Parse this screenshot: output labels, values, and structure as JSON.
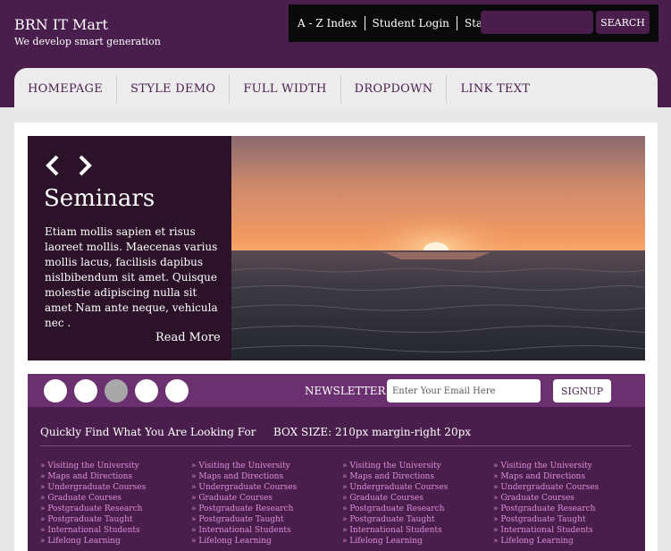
{
  "brand": {
    "name": "BRN IT Mart",
    "tagline": "We develop smart generation"
  },
  "toplinks": [
    "A - Z Index",
    "Student Login",
    "Staff Login"
  ],
  "search": {
    "button": "SEARCH"
  },
  "nav": [
    "HOMEPAGE",
    "STYLE DEMO",
    "FULL WIDTH",
    "DROPDOWN",
    "LINK TEXT"
  ],
  "slide": {
    "title": "Seminars",
    "body": "Etiam mollis sapien et risus laoreet mollis. Maecenas varius mollis lacus, facilisis dapibus nislbibendum sit amet. Quisque molestie adipiscing nulla sit amet Nam ante neque, vehicula nec .",
    "more": "Read More",
    "prev_icon": "chevron-left-icon",
    "next_icon": "chevron-right-icon"
  },
  "pager": {
    "count": 5,
    "active_index": 2
  },
  "newsletter": {
    "label": "NEWSLETTER:",
    "placeholder": "Enter Your Email Here",
    "button": "SIGNUP"
  },
  "quick": {
    "heading": "Quickly Find What You Are Looking For",
    "box_size": "BOX SIZE: 210px margin-right 20px",
    "columns": [
      [
        "» Visiting the University",
        "» Maps and Directions",
        "» Undergraduate Courses",
        "» Graduate Courses",
        "» Postgraduate Research",
        "» Postgraduate Taught",
        "» International Students",
        "» Lifelong Learning"
      ],
      [
        "» Visiting the University",
        "» Maps and Directions",
        "» Undergraduate Courses",
        "» Graduate Courses",
        "» Postgraduate Research",
        "» Postgraduate Taught",
        "» International Students",
        "» Lifelong Learning"
      ],
      [
        "» Visiting the University",
        "» Maps and Directions",
        "» Undergraduate Courses",
        "» Graduate Courses",
        "» Postgraduate Research",
        "» Postgraduate Taught",
        "» International Students",
        "» Lifelong Learning"
      ],
      [
        "» Visiting the University",
        "» Maps and Directions",
        "» Undergraduate Courses",
        "» Graduate Courses",
        "» Postgraduate Research",
        "» Postgraduate Taught",
        "» International Students",
        "» Lifelong Learning"
      ]
    ]
  },
  "colors": {
    "brand": "#4a1e4c",
    "bar": "#6b3070",
    "caption": "#2c1228",
    "link": "#d98fd8"
  }
}
